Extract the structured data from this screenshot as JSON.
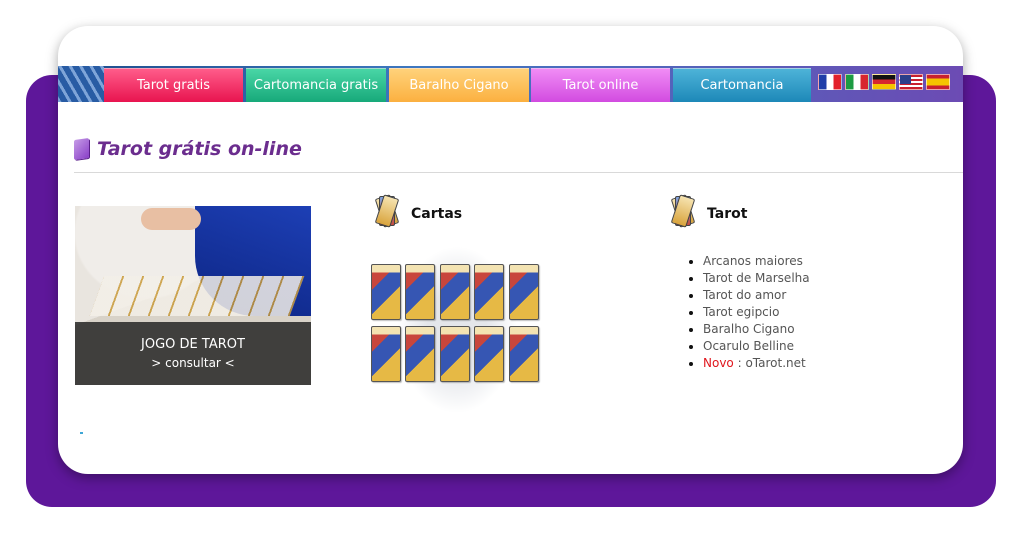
{
  "nav": {
    "tabs": [
      {
        "label": "Tarot gratis",
        "color": "#e8144f"
      },
      {
        "label": "Cartomancia gratis",
        "color": "#17a97a"
      },
      {
        "label": "Baralho Cigano",
        "color": "#fbb040"
      },
      {
        "label": "Tarot online",
        "color": "#d24be0"
      },
      {
        "label": "Cartomancia",
        "color": "#1d88b8"
      }
    ],
    "flags": [
      "flag-france-icon",
      "flag-italy-icon",
      "flag-germany-icon",
      "flag-usa-icon",
      "flag-spain-icon"
    ]
  },
  "page": {
    "title": "Tarot grátis on-line",
    "title_color": "#6b2d8e",
    "backdrop_color": "#5e179a"
  },
  "promo": {
    "title": "JOGO DE TAROT",
    "subtitle": "> consultar <"
  },
  "cartas": {
    "heading": "Cartas"
  },
  "tarot": {
    "heading": "Tarot",
    "links": [
      "Arcanos maiores",
      "Tarot de Marselha",
      "Tarot do amor",
      "Tarot egipcio",
      "Baralho Cigano",
      "Ocarulo Belline"
    ],
    "new_label": "Novo",
    "new_sep": " : ",
    "new_link": "oTarot.net",
    "new_label_color": "#e0161d"
  }
}
